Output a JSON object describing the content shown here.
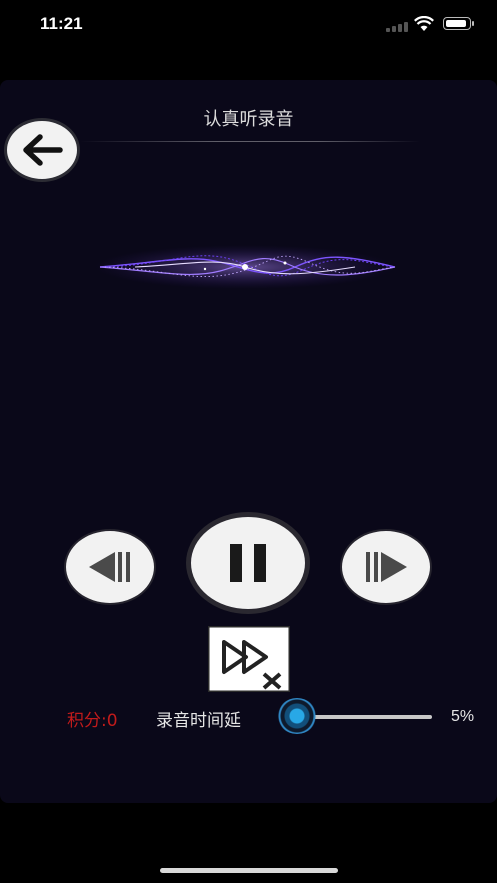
{
  "status_bar": {
    "time": "11:21"
  },
  "header": {
    "title": "认真听录音"
  },
  "icons": {
    "back": "arrow-left-icon",
    "wave": "sound-wave-icon",
    "prev": "previous-track-icon",
    "pause": "pause-icon",
    "next": "next-track-icon",
    "skip": "skip-close-icon"
  },
  "player": {
    "state": "playing"
  },
  "footer": {
    "score_label": "积分:0",
    "delay_label": "录音时间延",
    "delay_value": "5%",
    "delay_fraction": 0.05
  },
  "colors": {
    "background": "#0a0819",
    "score": "#c11b1b",
    "accent": "#28a8e6",
    "wave": "#8a5cff"
  }
}
